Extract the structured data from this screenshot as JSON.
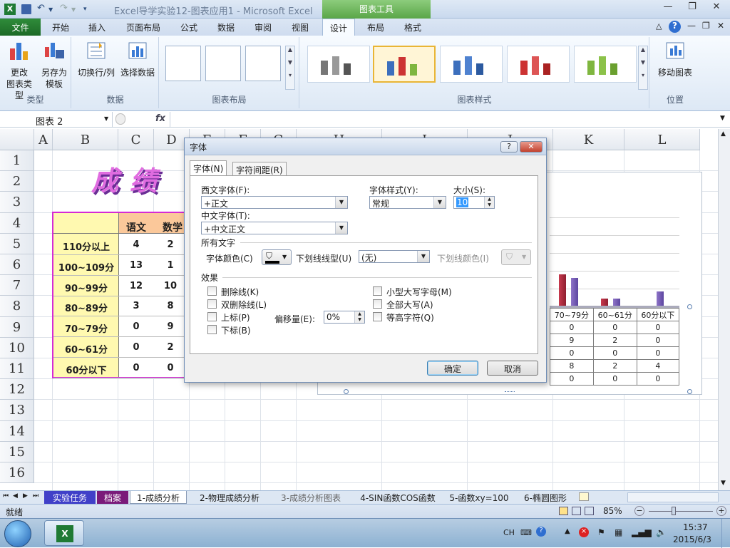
{
  "window": {
    "title": "Excel导学实验12-图表应用1 - Microsoft Excel",
    "tools_tab": "图表工具"
  },
  "tabs": [
    "文件",
    "开始",
    "插入",
    "页面布局",
    "公式",
    "数据",
    "审阅",
    "视图",
    "设计",
    "布局",
    "格式"
  ],
  "active_tab": "设计",
  "ribbon": {
    "type_group": {
      "label": "类型",
      "btn1": "更改\n图表类型",
      "btn1_a": "更改",
      "btn1_b": "图表类型",
      "btn2_a": "另存为",
      "btn2_b": "模板"
    },
    "data_group": {
      "label": "数据",
      "btn1": "切换行/列",
      "btn2": "选择数据"
    },
    "layout_group": {
      "label": "图表布局"
    },
    "styles_group": {
      "label": "图表样式"
    },
    "location_group": {
      "label": "位置",
      "btn1": "移动图表"
    }
  },
  "formula_bar": {
    "name_box": "图表 2",
    "fx": "fx"
  },
  "columns": [
    "A",
    "B",
    "C",
    "D",
    "E",
    "F",
    "G",
    "H",
    "I",
    "J",
    "K",
    "L"
  ],
  "rows": [
    "1",
    "2",
    "3",
    "4",
    "5",
    "6",
    "7",
    "8",
    "9",
    "10",
    "11",
    "12",
    "13",
    "14",
    "15",
    "16"
  ],
  "sheet_title": "成绩",
  "table": {
    "headers": [
      "语文",
      "数学"
    ],
    "rows": [
      {
        "label": "110分以上",
        "c": "4",
        "d": "2"
      },
      {
        "label": "100~109分",
        "c": "13",
        "d": "1"
      },
      {
        "label": "90~99分",
        "c": "12",
        "d": "10"
      },
      {
        "label": "80~89分",
        "c": "3",
        "d": "8"
      },
      {
        "label": "70~79分",
        "c": "0",
        "d": "9"
      },
      {
        "label": "60~61分",
        "c": "0",
        "d": "2"
      },
      {
        "label": "60分以下",
        "c": "0",
        "d": "0"
      }
    ]
  },
  "chart": {
    "table_headers": [
      "70~79分",
      "60~61分",
      "60分以下"
    ],
    "table_rows": [
      [
        "0",
        "0",
        "0"
      ],
      [
        "9",
        "2",
        "0"
      ],
      [
        "0",
        "0",
        "0"
      ],
      [
        "8",
        "2",
        "4"
      ],
      [
        "0",
        "0",
        "0"
      ]
    ]
  },
  "dialog": {
    "title": "字体",
    "help": "?",
    "close": "✕",
    "tab1": "字体(N)",
    "tab2": "字符间距(R)",
    "western_label": "西文字体(F):",
    "western_value": "+正文",
    "style_label": "字体样式(Y):",
    "style_value": "常规",
    "size_label": "大小(S):",
    "size_value": "10",
    "asian_label": "中文字体(T):",
    "asian_value": "+中文正文",
    "all_text": "所有文字",
    "color_label": "字体颜色(C)",
    "underline_label": "下划线线型(U)",
    "underline_value": "(无)",
    "underline_color_label": "下划线颜色(I)",
    "effects": "效果",
    "strike": "删除线(K)",
    "dstrike": "双删除线(L)",
    "superscript": "上标(P)",
    "offset_label": "偏移量(E):",
    "offset_value": "0%",
    "subscript": "下标(B)",
    "smallcaps": "小型大写字母(M)",
    "allcaps": "全部大写(A)",
    "equalheight": "等高字符(Q)",
    "ok": "确定",
    "cancel": "取消"
  },
  "sheet_tabs": [
    "实验任务",
    "档案",
    "1-成绩分析",
    "2-物理成绩分析",
    "3-成绩分析图表",
    "4-SIN函数COS函数",
    "5-函数xy=100",
    "6-椭圆图形"
  ],
  "active_sheet": "1-成绩分析",
  "status": {
    "ready": "就绪",
    "zoom": "85%"
  },
  "taskbar": {
    "lang": "CH",
    "time": "15:37",
    "date": "2015/6/3"
  }
}
